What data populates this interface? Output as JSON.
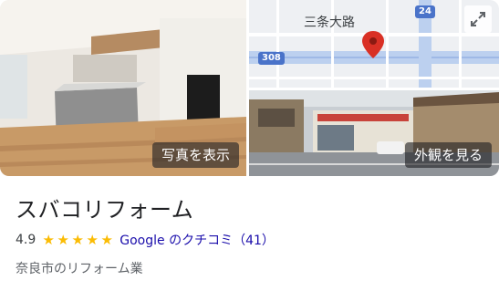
{
  "photos": {
    "main_button": "写真を表示",
    "street_button": "外観を見る"
  },
  "map": {
    "street_label": "三条大路",
    "route_308": "308",
    "route_24": "24",
    "pin_color": "#d93025"
  },
  "business": {
    "name": "スバコリフォーム",
    "rating": "4.9",
    "star_count": 5,
    "review_link": "Google のクチコミ（41）",
    "category": "奈良市のリフォーム業"
  },
  "colors": {
    "star": "#fbbc04",
    "link": "#1a0dab"
  }
}
